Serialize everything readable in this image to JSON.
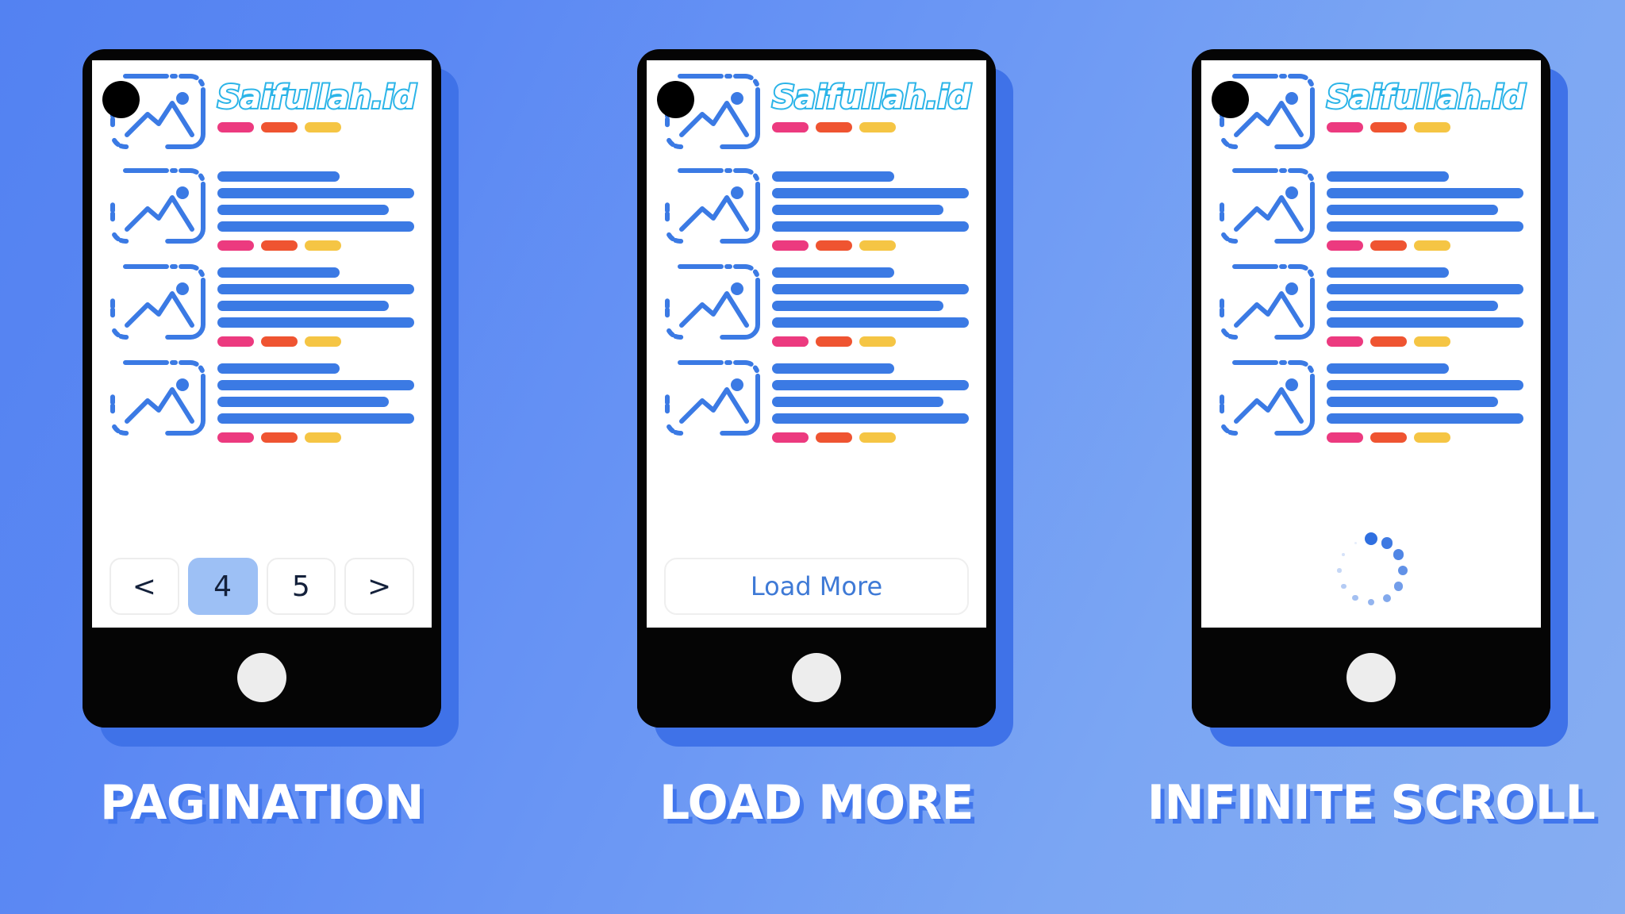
{
  "background": {
    "gradient_from": "#5382f2",
    "gradient_to": "#86adf2"
  },
  "brand": {
    "name": "Saifullah.id",
    "text_color": "#ffffff",
    "outline_color": "#2bb4e8"
  },
  "colors": {
    "bar_blue": "#3b7ae4",
    "tag_pink": "#ec3a7f",
    "tag_orange": "#ef5431",
    "tag_yellow": "#f5c544",
    "active_page": "#9dc0f5",
    "link_blue": "#3f7ad6",
    "shadow_blue": "#4176ec"
  },
  "panels": [
    {
      "id": "pagination",
      "caption": "PAGINATION",
      "footer_type": "pagination",
      "rows": [
        {
          "type": "brand",
          "bars": [],
          "tags": [
            "pink",
            "orange",
            "yellow"
          ]
        },
        {
          "type": "text",
          "bars": [
            62,
            100,
            87,
            100
          ],
          "tags": [
            "pink",
            "orange",
            "yellow"
          ]
        },
        {
          "type": "text",
          "bars": [
            62,
            100,
            87,
            100
          ],
          "tags": [
            "pink",
            "orange",
            "yellow"
          ]
        },
        {
          "type": "text",
          "bars": [
            62,
            100,
            87,
            100
          ],
          "tags": [
            "pink",
            "orange",
            "yellow"
          ]
        }
      ],
      "pagination": {
        "prev_label": "<",
        "next_label": ">",
        "pages": [
          {
            "label": "4",
            "active": true
          },
          {
            "label": "5",
            "active": false
          }
        ]
      }
    },
    {
      "id": "load-more",
      "caption": "LOAD MORE",
      "footer_type": "load_more",
      "rows": [
        {
          "type": "brand",
          "bars": [],
          "tags": [
            "pink",
            "orange",
            "yellow"
          ]
        },
        {
          "type": "text",
          "bars": [
            62,
            100,
            87,
            100
          ],
          "tags": [
            "pink",
            "orange",
            "yellow"
          ]
        },
        {
          "type": "text",
          "bars": [
            62,
            100,
            87,
            100
          ],
          "tags": [
            "pink",
            "orange",
            "yellow"
          ]
        },
        {
          "type": "text",
          "bars": [
            62,
            100,
            87,
            100
          ],
          "tags": [
            "pink",
            "orange",
            "yellow"
          ]
        }
      ],
      "load_more": {
        "label": "Load More"
      }
    },
    {
      "id": "infinite-scroll",
      "caption": "INFINITE SCROLL",
      "footer_type": "spinner",
      "rows": [
        {
          "type": "brand",
          "bars": [],
          "tags": [
            "pink",
            "orange",
            "yellow"
          ]
        },
        {
          "type": "text",
          "bars": [
            62,
            100,
            87,
            100
          ],
          "tags": [
            "pink",
            "orange",
            "yellow"
          ]
        },
        {
          "type": "text",
          "bars": [
            62,
            100,
            87,
            100
          ],
          "tags": [
            "pink",
            "orange",
            "yellow"
          ]
        },
        {
          "type": "text",
          "bars": [
            62,
            100,
            87,
            100
          ],
          "tags": [
            "pink",
            "orange",
            "yellow"
          ]
        }
      ],
      "spinner": {
        "label": "loading-spinner",
        "dot_count": 12
      }
    }
  ]
}
